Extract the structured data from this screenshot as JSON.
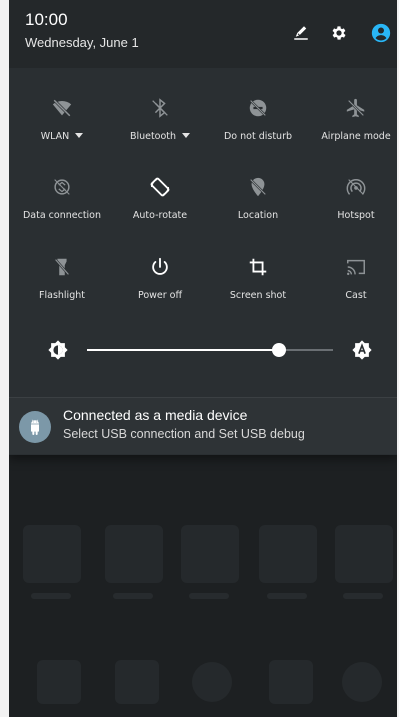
{
  "status_bar": {
    "time": "10:00",
    "date": "Wednesday, June 1",
    "icons": [
      "edit-icon",
      "gear-icon",
      "account-icon"
    ],
    "account_color": "#29b6f6"
  },
  "quick_settings": {
    "tiles": [
      {
        "label": "WLAN",
        "icon": "wifi-off-icon",
        "dropdown": true
      },
      {
        "label": "Bluetooth",
        "icon": "bluetooth-icon",
        "dropdown": true
      },
      {
        "label": "Do not disturb",
        "icon": "do-not-disturb-icon",
        "dropdown": false
      },
      {
        "label": "Airplane mode",
        "icon": "airplane-icon",
        "dropdown": false
      },
      {
        "label": "Data connection",
        "icon": "data-connection-icon",
        "dropdown": false
      },
      {
        "label": "Auto-rotate",
        "icon": "auto-rotate-icon",
        "dropdown": false
      },
      {
        "label": "Location",
        "icon": "location-off-icon",
        "dropdown": false
      },
      {
        "label": "Hotspot",
        "icon": "hotspot-icon",
        "dropdown": false
      },
      {
        "label": "Flashlight",
        "icon": "flashlight-icon",
        "dropdown": false
      },
      {
        "label": "Power off",
        "icon": "power-icon",
        "dropdown": false
      },
      {
        "label": "Screen shot",
        "icon": "crop-icon",
        "dropdown": false
      },
      {
        "label": "Cast",
        "icon": "cast-icon",
        "dropdown": false
      }
    ]
  },
  "brightness": {
    "level": 0.78,
    "icons": [
      "brightness-icon",
      "auto-brightness-icon"
    ]
  },
  "notification": {
    "title": "Connected as a media device",
    "text": "Select USB connection and Set USB debug",
    "icon": "android-icon",
    "icon_color": "#7c98a8"
  }
}
